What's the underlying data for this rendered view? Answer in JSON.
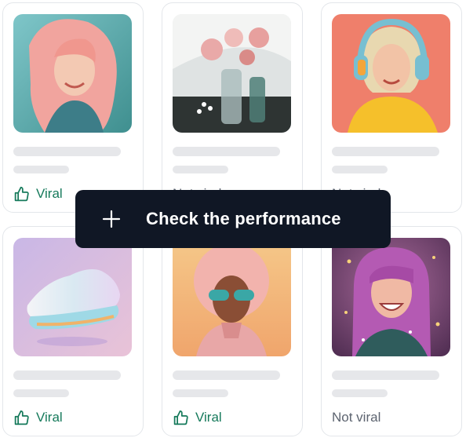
{
  "cta": {
    "label": "Check the performance",
    "icon": "plus-icon"
  },
  "cards": [
    {
      "image": "woman with pink hair smiling",
      "status": "Viral",
      "status_type": "viral",
      "icon": "thumbs-up-icon"
    },
    {
      "image": "pink flowers in glass vases",
      "status": "Not viral",
      "status_type": "notviral"
    },
    {
      "image": "woman wearing headphones",
      "status": "Not viral",
      "status_type": "notviral"
    },
    {
      "image": "iridescent sneaker",
      "status": "Viral",
      "status_type": "viral",
      "icon": "thumbs-up-icon"
    },
    {
      "image": "person with pink afro and sunglasses",
      "status": "Viral",
      "status_type": "viral",
      "icon": "thumbs-up-icon"
    },
    {
      "image": "woman with purple hair laughing",
      "status": "Not viral",
      "status_type": "notviral"
    }
  ],
  "colors": {
    "viral": "#167a5b",
    "not_viral": "#5d6470",
    "cta_bg": "#101725"
  }
}
